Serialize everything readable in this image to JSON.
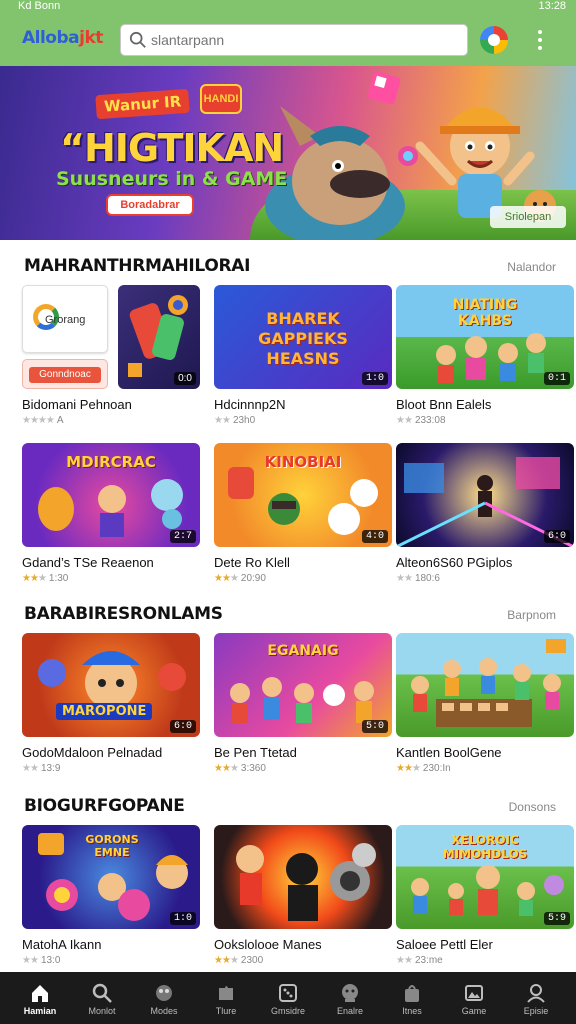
{
  "status_bar": {
    "left": "Kd Bonn",
    "right": "13:28"
  },
  "header": {
    "logo_part1": "Alloba",
    "logo_part2": "jkt",
    "search_placeholder": "slantarpann"
  },
  "banner": {
    "tag": "Wanur IR",
    "badge": "HANDI",
    "title": "“HIGTIKAN",
    "subtitle": "Suusneurs in & GAME",
    "primary_button": "Boradabrar",
    "secondary_button": "Sriolepan"
  },
  "sections": [
    {
      "title": "MAHRANTHRMAHILORAI",
      "more": "Nalandor",
      "rows": [
        [
          {
            "name": "Bidomani Pehnoan",
            "meta": "★★★★ A",
            "badge": "",
            "logo_text": "Grorang",
            "button_text": "Gonndnoac"
          },
          {
            "name": "Hdcinnnp2N",
            "meta": "ㅤ 2ᴈ10",
            "rating": "23h0",
            "badge": "1:0"
          },
          {
            "name": "Bloot Bnn Ealels",
            "rating": "233:08",
            "badge": "0:1"
          }
        ],
        [
          {
            "name": "Gdand’s TSe Reaenon",
            "rating": "1:30",
            "badge": "2:7"
          },
          {
            "name": "Dete Ro Klell",
            "rating": "20:90",
            "badge": "4:0"
          },
          {
            "name": "Alteon6S60 PGiplos",
            "rating": "180:6",
            "badge": "6:0"
          }
        ]
      ]
    },
    {
      "title": "BARABIRESRONLAMS",
      "more": "Barpnom",
      "rows": [
        [
          {
            "name": "GodoMdaloon Pelnadad",
            "rating": "13:9",
            "badge": "6:0"
          },
          {
            "name": "Be Pen Ttetad",
            "rating": "3:360",
            "badge": "5:0"
          },
          {
            "name": "Kantlen BoolGene",
            "rating": "230:In",
            "badge": ""
          }
        ]
      ]
    },
    {
      "title": "BIOGURFGOPANE",
      "more": "Donsons",
      "rows": [
        [
          {
            "name": "MatohA Ikann",
            "rating": "13:0",
            "badge": "1:0"
          },
          {
            "name": "Ookslolooe Manes",
            "rating": "2300",
            "badge": ""
          },
          {
            "name": "Saloee Pettl Eler",
            "rating": "23:me",
            "badge": "5:9"
          }
        ]
      ]
    }
  ],
  "card_labels": {
    "r1c1": "Bidomani Pehnoan",
    "r1c1_meta": "A",
    "r1c2": "Hdcinnnp2N",
    "r1c2_meta": "23h0",
    "r1c2_badge": "1:0",
    "r1c3": "Bloot Bnn Ealels",
    "r1c3_meta": "233:08",
    "r1c3_badge": "0:1",
    "r2c1": "Gdand’s TSe Reaenon",
    "r2c1_meta": "1:30",
    "r2c1_badge": "2:7",
    "r2c2": "Dete Ro Klell",
    "r2c2_meta": "20:90",
    "r2c2_badge": "4:0",
    "r2c3": "Alteon6S60 PGiplos",
    "r2c3_meta": "180:6",
    "r2c3_badge": "6:0",
    "r3c1": "GodoMdaloon Pelnadad",
    "r3c1_meta": "13:9",
    "r3c1_badge": "6:0",
    "r3c2": "Be Pen Ttetad",
    "r3c2_meta": "3:360",
    "r3c2_badge": "5:0",
    "r3c3": "Kantlen BoolGene",
    "r3c3_meta": "230:In",
    "r4c1": "MatohA Ikann",
    "r4c1_meta": "13:0",
    "r4c1_badge": "1:0",
    "r4c2": "Ookslolooe Manes",
    "r4c2_meta": "2300",
    "r4c3": "Saloee Pettl Eler",
    "r4c3_meta": "23:me",
    "r4c3_badge": "5:9",
    "thumb_r1c2_text": "BHAREK GAPPIEKS HEASNS",
    "thumb_r1c3_text": "NIATING KAHBS",
    "thumb_r2c1_text": "MDIRCRAC",
    "thumb_r2c2_text": "KINOBIAI",
    "thumb_r3c1_text": "MAROPONE",
    "thumb_r3c2_text": "EGANAIG",
    "thumb_r4c1_text": "GORONS EMNE",
    "thumb_r4c3_text": "XELOROIC MIMOHDLOS"
  },
  "bottom_nav": [
    {
      "label": "Hamian",
      "icon": "home-icon",
      "active": true
    },
    {
      "label": "Monlot",
      "icon": "search-icon"
    },
    {
      "label": "Modes",
      "icon": "game-icon"
    },
    {
      "label": "Tlure",
      "icon": "puzzle-icon"
    },
    {
      "label": "Gmsidre",
      "icon": "dice-icon"
    },
    {
      "label": "Enalre",
      "icon": "mascot-icon"
    },
    {
      "label": "Itnes",
      "icon": "bag-icon"
    },
    {
      "label": "Game",
      "icon": "image-icon"
    },
    {
      "label": "Episie",
      "icon": "profile-icon"
    }
  ],
  "colors": {
    "header_bg": "#82c46d",
    "nav_bg": "#1b1b1b",
    "accent_red": "#e8402f",
    "star_gold": "#e9a92a"
  }
}
